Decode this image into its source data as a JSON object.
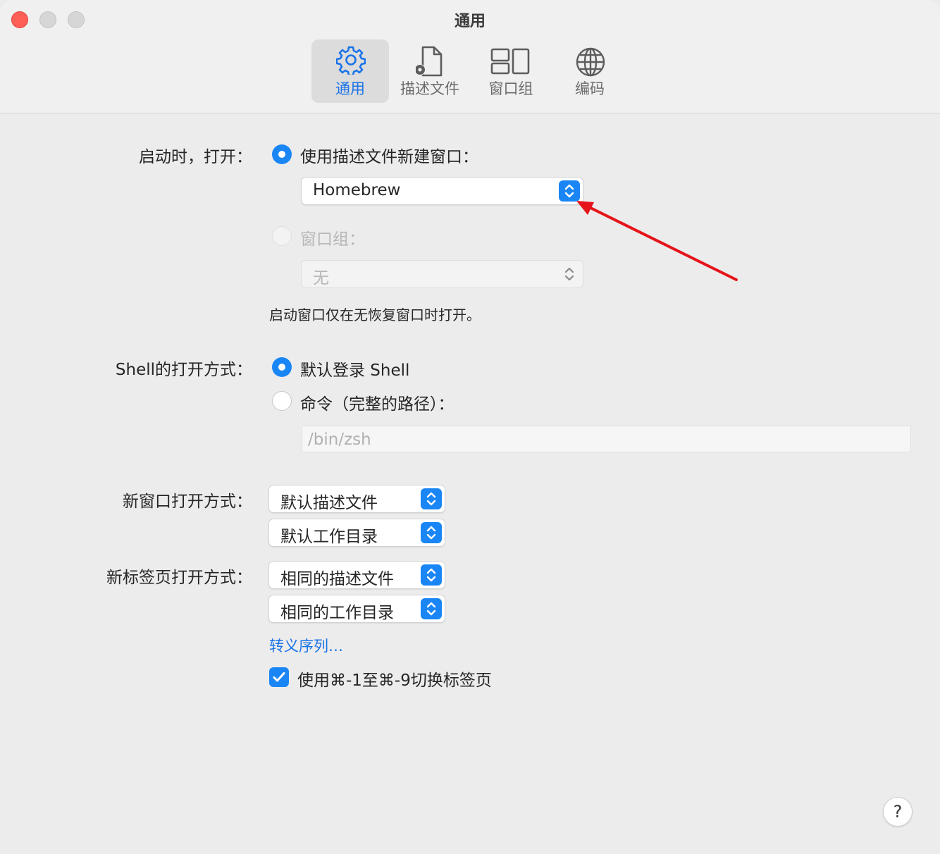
{
  "window": {
    "title": "通用"
  },
  "toolbar": {
    "tabs": [
      {
        "label": "通用",
        "icon": "gear-icon",
        "active": true
      },
      {
        "label": "描述文件",
        "icon": "profile-document-icon",
        "active": false
      },
      {
        "label": "窗口组",
        "icon": "window-group-icon",
        "active": false
      },
      {
        "label": "编码",
        "icon": "globe-icon",
        "active": false
      }
    ]
  },
  "startup": {
    "label": "启动时，打开：",
    "option_profile": "使用描述文件新建窗口：",
    "profile_value": "Homebrew",
    "option_group": "窗口组：",
    "group_value": "无",
    "note": "启动窗口仅在无恢复窗口时打开。"
  },
  "shell": {
    "label": "Shell的打开方式：",
    "option_default": "默认登录 Shell",
    "option_command": "命令（完整的路径）：",
    "command_placeholder": "/bin/zsh"
  },
  "new_window": {
    "label": "新窗口打开方式：",
    "profile": "默认描述文件",
    "directory": "默认工作目录"
  },
  "new_tab": {
    "label": "新标签页打开方式：",
    "profile": "相同的描述文件",
    "directory": "相同的工作目录"
  },
  "escape_sequences_link": "转义序列…",
  "shortcut_checkbox": {
    "label": "使用⌘-1至⌘-9切换标签页",
    "checked": true
  },
  "help": "?",
  "colors": {
    "accent": "#1a86f5",
    "annotation_arrow": "#e5141a"
  }
}
